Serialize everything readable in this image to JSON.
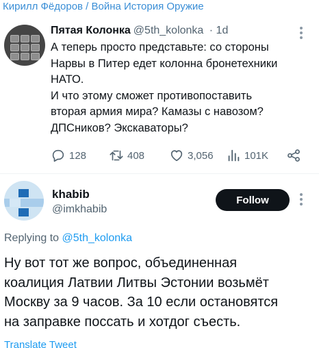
{
  "channel": {
    "title": "Кирилл Фёдоров / Война История Оружие"
  },
  "quoted_tweet": {
    "author_name": "Пятая Колонка",
    "author_handle": "@5th_kolonka",
    "time": "· 1d",
    "text_lines": [
      "А теперь просто представьте: со стороны",
      "Нарвы в Питер едет колонна бронетехники",
      "НАТО.",
      "И что этому сможет противопоставить",
      "вторая армия мира? Камазы с навозом?",
      "ДПСников? Экскаваторы?"
    ],
    "stats": {
      "replies": "128",
      "retweets": "408",
      "likes": "3,056",
      "views": "101K"
    },
    "icons": [
      "comment-icon",
      "retweet-icon",
      "heart-icon",
      "views-icon",
      "share-icon",
      "more-icon"
    ]
  },
  "reply_tweet": {
    "author_name": "khabib",
    "author_handle": "@imkhabib",
    "follow_label": "Follow",
    "replying_prefix": "Replying to",
    "replying_to": "@5th_kolonka",
    "text_lines": [
      "Ну вот тот же вопрос, объединенная",
      "коалиция Латвии Литвы Эстонии возьмёт",
      "Москву за 9 часов. За 10 если остановятся",
      "на заправке поссать и хотдог съесть."
    ],
    "translate_label": "Translate Tweet"
  },
  "colors": {
    "accent": "#1d9bf0",
    "channel_link": "#3a8ed6",
    "text": "#0f1419",
    "secondary_text": "#536471",
    "follow_bg": "#0f1419"
  }
}
